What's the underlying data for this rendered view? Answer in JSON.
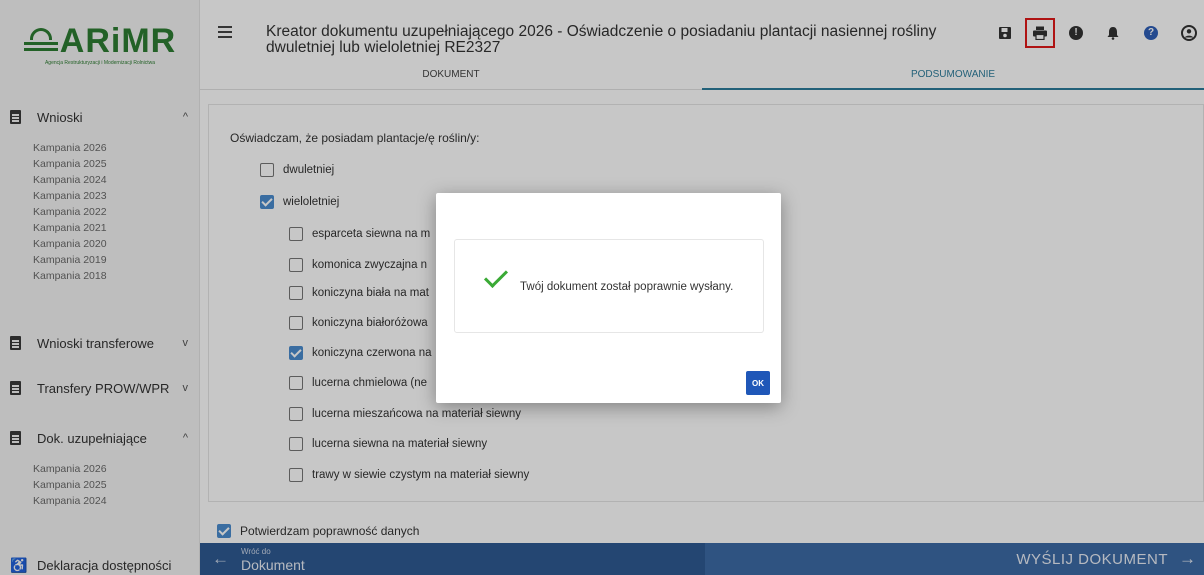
{
  "logo": {
    "text": "ARiMR",
    "subtitle": "Agencja Restrukturyzacji i Modernizacji Rolnictwa"
  },
  "sidebar": {
    "sections": [
      {
        "label": "Wnioski",
        "chevron": "^",
        "items": [
          "Kampania 2026",
          "Kampania 2025",
          "Kampania 2024",
          "Kampania 2023",
          "Kampania 2022",
          "Kampania 2021",
          "Kampania 2020",
          "Kampania 2019",
          "Kampania 2018"
        ]
      },
      {
        "label": "Wnioski transferowe",
        "chevron": "v",
        "items": []
      },
      {
        "label": "Transfery PROW/WPR",
        "chevron": "v",
        "items": []
      },
      {
        "label": "Dok. uzupełniające",
        "chevron": "^",
        "items": [
          "Kampania 2026",
          "Kampania 2025",
          "Kampania 2024"
        ]
      },
      {
        "label": "Deklaracja dostępności",
        "chevron": "",
        "items": []
      }
    ]
  },
  "header": {
    "title": "Kreator dokumentu uzupełniającego 2026 - Oświadczenie o posiadaniu plantacji nasiennej rośliny dwuletniej lub wieloletniej RE2327",
    "icons": [
      "save-icon",
      "print-icon",
      "alert-icon",
      "bell-icon",
      "help-icon",
      "account-icon"
    ],
    "highlight_color": "#e01919"
  },
  "tabs": {
    "document": "DOKUMENT",
    "summary": "PODSUMOWANIE"
  },
  "form": {
    "statement": "Oświadczam, że posiadam plantacje/ę roślin/y:",
    "options": [
      {
        "label": "dwuletniej",
        "checked": false
      },
      {
        "label": "wieloletniej",
        "checked": true
      }
    ],
    "plants": [
      {
        "label": "esparceta siewna na m",
        "checked": false
      },
      {
        "label": "komonica zwyczajna n",
        "checked": false
      },
      {
        "label": "koniczyna biała na mat",
        "checked": false
      },
      {
        "label": "koniczyna białoróżowa",
        "checked": false
      },
      {
        "label": "koniczyna czerwona na",
        "checked": true
      },
      {
        "label": "lucerna chmielowa (ne",
        "checked": false
      },
      {
        "label": "lucerna mieszańcowa na materiał siewny",
        "checked": false
      },
      {
        "label": "lucerna siewna na materiał siewny",
        "checked": false
      },
      {
        "label": "trawy w siewie czystym na materiał siewny",
        "checked": false
      }
    ],
    "confirm": {
      "label": "Potwierdzam poprawność danych",
      "checked": true
    }
  },
  "dialog": {
    "message": "Twój dokument został poprawnie wysłany.",
    "ok_label": "OK"
  },
  "bottom": {
    "back_small": "Wróć do",
    "back_big": "Dokument",
    "send_label": "WYŚLIJ DOKUMENT",
    "back_arrow": "←",
    "send_arrow": "→"
  },
  "colors": {
    "brand_green": "#2e7d32",
    "bar_blue": "#2f5a93",
    "checkbox_blue": "#4b8ccf",
    "ok_blue": "#1f57b8"
  }
}
